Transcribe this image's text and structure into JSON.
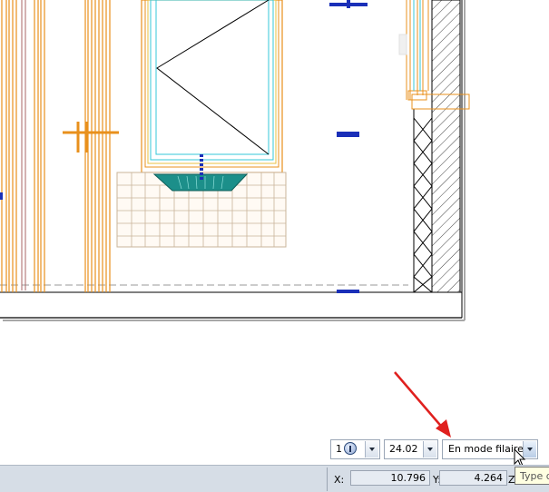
{
  "view_controls": {
    "layer_value": "1",
    "zoom_value": "24.02",
    "display_mode_value": "En mode filaire"
  },
  "status_bar": {
    "x_label": "X:",
    "x_value": "10.796",
    "y_label": "Y:",
    "y_value": "4.264",
    "z_label": "Z"
  },
  "tooltip": {
    "text": "Type d"
  },
  "colors": {
    "cad_orange": "#e8901c",
    "cad_cyan": "#36c7d8",
    "cad_teal": "#1c8f8a",
    "cad_blue": "#1a2fb8",
    "annotation_red": "#e0201e",
    "statusbar_bg": "#d6dde6"
  }
}
